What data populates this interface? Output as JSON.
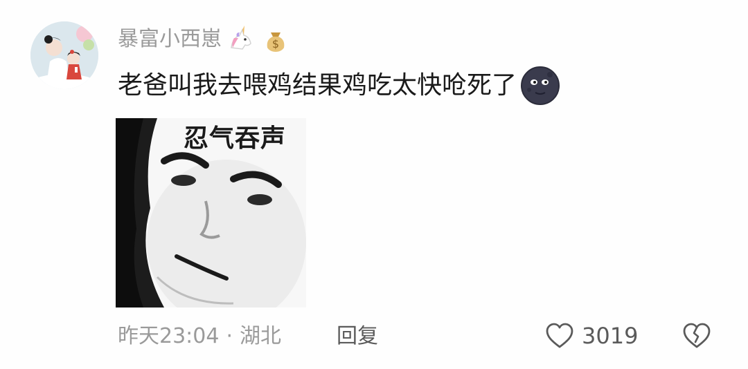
{
  "comment": {
    "username": "暴富小西崽",
    "badges": [
      "unicorn-icon",
      "money-bag-icon"
    ],
    "text": "老爸叫我去喂鸡结果鸡吃太快呛死了",
    "text_emoji": "moon-face-emoji-icon",
    "sticker": {
      "caption": "忍气吞声"
    },
    "footer": {
      "time": "昨天23:04",
      "separator": "·",
      "location": "湖北",
      "reply_label": "回复"
    },
    "likes": {
      "count": "3019",
      "like_icon": "heart-icon",
      "dislike_icon": "broken-heart-icon"
    }
  },
  "colors": {
    "background": "#fefefe",
    "username": "#9a9a9a",
    "text": "#1a1a1a",
    "meta": "#9a9a9a",
    "action": "#5a5a5a"
  }
}
